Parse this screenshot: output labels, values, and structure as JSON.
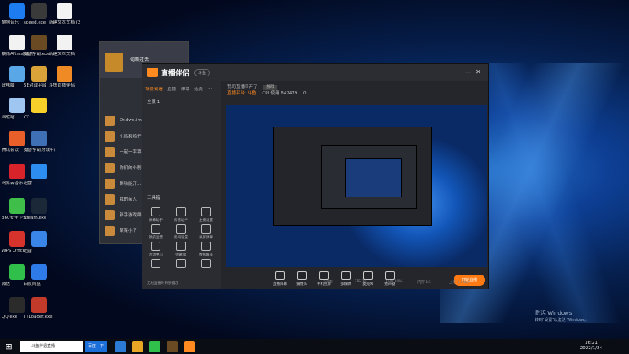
{
  "desktop": {
    "icons": [
      {
        "label": "酷狗音乐",
        "color": "#1d7df0"
      },
      {
        "label": "speed.exe",
        "color": "#3a3a3a"
      },
      {
        "label": "新建文本文档 (2)",
        "color": "#f3f3f3"
      },
      {
        "label": "暴雨After动画片",
        "color": "#f2f2f2"
      },
      {
        "label": "魔兽争霸.exe",
        "color": "#6a4a22"
      },
      {
        "label": "新建文本文档",
        "color": "#f2f2f2"
      },
      {
        "label": "此电脑",
        "color": "#5aa7e8"
      },
      {
        "label": "5E对战平台",
        "color": "#d9a33a"
      },
      {
        "label": "斗鱼直播伴侣",
        "color": "#f08a24"
      },
      {
        "label": "回收站",
        "color": "#9fc6f0"
      },
      {
        "label": "YY",
        "color": "#f7d12a"
      },
      {
        "label": "腾讯会议",
        "color": "#e85f2a"
      },
      {
        "label": "魔兽争霸对战平台",
        "color": "#3f6fb5"
      },
      {
        "label": "网易云音乐",
        "color": "#d8232a"
      },
      {
        "label": "迅雷",
        "color": "#2d8df0"
      },
      {
        "label": "360安全卫士",
        "color": "#3fbf4a"
      },
      {
        "label": "Steam.exe",
        "color": "#1b2838"
      },
      {
        "label": "WPS Office",
        "color": "#d6332d"
      },
      {
        "label": "迅雷",
        "color": "#3a86e8"
      },
      {
        "label": "微信",
        "color": "#2fbf4a"
      },
      {
        "label": "百度网盘",
        "color": "#2e7ae8"
      },
      {
        "label": "QQ.exe",
        "color": "#2b2b2b"
      },
      {
        "label": "TTLoader.exe",
        "color": "#c23a2a"
      }
    ]
  },
  "chat": {
    "name": "何雨过活",
    "rows": [
      "Dr.dwd.im",
      "小鸡和鸭子",
      "一起一字幕",
      "你们的小剧...",
      "群功能开...",
      "我的亲人",
      "新手游戏群",
      "某某小子"
    ]
  },
  "app": {
    "title": "直播伴侣",
    "badge": "斗鱼",
    "tabs": [
      "场景观看",
      "直播",
      "弹幕",
      "连麦",
      "..."
    ],
    "active_tab": "场景观看",
    "scene_label": "全景 1",
    "tool_section": "工具箱",
    "tools": [
      "弹幕助手",
      "房管助手",
      "主播设置",
      "领航运营",
      "房间设置",
      "录屏弹幕",
      "活动中心",
      "弹幕墙",
      "数据概览",
      "",
      "",
      ""
    ],
    "notice": "无线直播时特别提示",
    "top_info": {
      "room": "我司直播间开了",
      "tag": "游戏",
      "line": "直播平台: 斗鱼",
      "cpu": "CPU使用 842479",
      "cnt": "0"
    },
    "controls": [
      "直播屏幕",
      "摄像头",
      "手机投屏",
      "多媒体",
      "麦克风",
      "扬声器"
    ],
    "start_label": "开始直播",
    "status": [
      "3码率",
      "FPS 30",
      "CPU 30%",
      "内存 1G",
      "上行 0.0Kb/s"
    ]
  },
  "watermark": {
    "line1": "激活 Windows",
    "line2": "转到\"设置\"以激活 Windows。"
  },
  "taskbar": {
    "search_placeholder": "百度一下",
    "search_text": "斗鱼伴侣直播",
    "go": "百度一下"
  },
  "clock": {
    "time": "16:21",
    "date": "2022/1/24"
  }
}
